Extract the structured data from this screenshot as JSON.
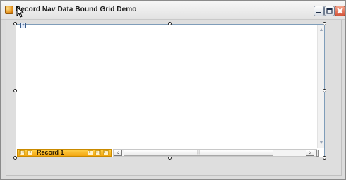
{
  "window": {
    "title": "Record Nav Data Bound Grid Demo"
  },
  "navigator": {
    "record_label": "Record 1"
  },
  "icons": {
    "app": "app-icon",
    "minimize": "minimize-icon",
    "maximize": "maximize-icon",
    "close": "close-icon",
    "first": "first-record-icon",
    "previous": "previous-record-icon",
    "next": "next-record-icon",
    "last": "last-record-icon",
    "new": "new-record-icon",
    "scroll_left": "scroll-left-icon",
    "scroll_right": "scroll-right-icon",
    "scroll_up": "scroll-up-icon",
    "scroll_down": "scroll-down-icon"
  },
  "colors": {
    "navigator_fill": "#f2a50e",
    "grid_background": "#ffffff",
    "form_background": "#dcdcdc"
  }
}
